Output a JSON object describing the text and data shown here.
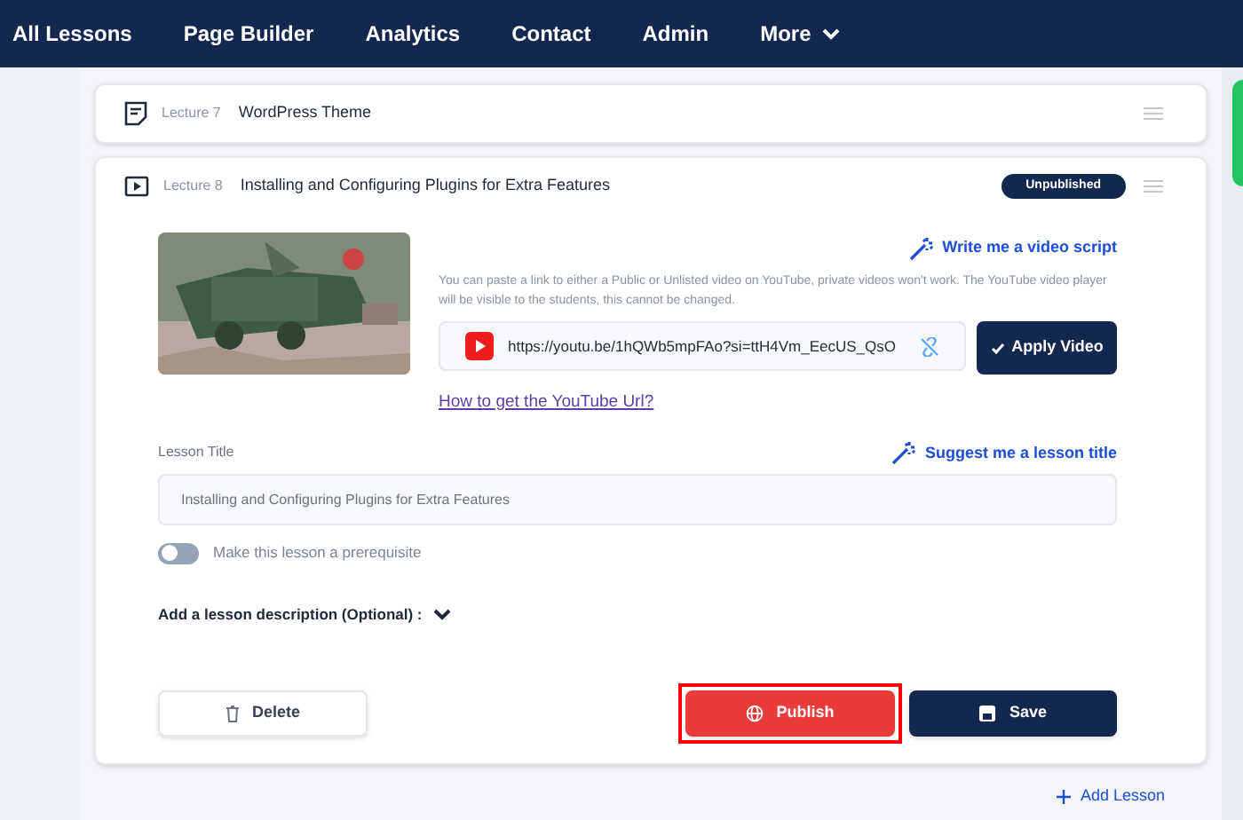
{
  "nav": {
    "items": [
      {
        "label": "All Lessons"
      },
      {
        "label": "Page Builder"
      },
      {
        "label": "Analytics"
      },
      {
        "label": "Contact"
      },
      {
        "label": "Admin"
      },
      {
        "label": "More",
        "dropdown": true
      }
    ]
  },
  "lectures": [
    {
      "kind": "text",
      "number": "Lecture 7",
      "title": "WordPress Theme"
    },
    {
      "kind": "video",
      "number": "Lecture 8",
      "title": "Installing and Configuring Plugins for Extra Features",
      "status": "Unpublished",
      "editor": {
        "script_link": "Write me a video script",
        "help": "You can paste a link to either a Public or Unlisted video on YouTube, private videos won't work. The YouTube video player will be visible to the students, this cannot be changed.",
        "url": "https://youtu.be/1hQWb5mpFAo?si=ttH4Vm_EecUS_QsO",
        "apply_button": "Apply Video",
        "howto_link": "How to get the YouTube Url?",
        "title_label": "Lesson Title",
        "suggest_link": "Suggest me a lesson title",
        "title_value": "Installing and Configuring Plugins for Extra Features",
        "prerequisite": {
          "label": "Make this lesson a prerequisite",
          "on": false
        },
        "description_toggle": "Add a lesson description (Optional) :",
        "buttons": [
          {
            "kind": "delete",
            "label": "Delete",
            "highlighted": false
          },
          {
            "kind": "publish",
            "label": "Publish",
            "highlighted": true
          },
          {
            "kind": "save",
            "label": "Save",
            "highlighted": false
          }
        ]
      }
    }
  ],
  "add_lesson": "Add Lesson"
}
